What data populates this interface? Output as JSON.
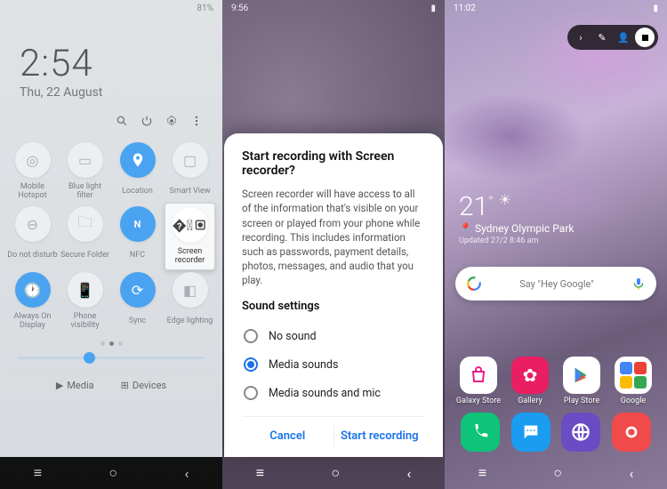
{
  "screen1": {
    "status_right": "81%",
    "time": "2:54",
    "date": "Thu, 22 August",
    "tiles": [
      {
        "label": "Mobile Hotspot",
        "active": false,
        "icon": "hotspot"
      },
      {
        "label": "Blue light filter",
        "active": false,
        "icon": "bluelight"
      },
      {
        "label": "Location",
        "active": true,
        "icon": "location"
      },
      {
        "label": "Smart View",
        "active": false,
        "icon": "smartview"
      },
      {
        "label": "Do not disturb",
        "active": false,
        "icon": "dnd"
      },
      {
        "label": "Secure Folder",
        "active": false,
        "icon": "folder"
      },
      {
        "label": "NFC",
        "active": true,
        "icon": "nfc"
      },
      {
        "label": "Screen recorder",
        "active": false,
        "icon": "record",
        "highlight": true
      },
      {
        "label": "Always On Display",
        "active": true,
        "icon": "aod"
      },
      {
        "label": "Phone visibility",
        "active": false,
        "icon": "visibility"
      },
      {
        "label": "Sync",
        "active": true,
        "icon": "sync"
      },
      {
        "label": "Edge lighting",
        "active": false,
        "icon": "edge"
      }
    ],
    "media_label": "Media",
    "devices_label": "Devices"
  },
  "screen2": {
    "status_time": "9:56",
    "dialog": {
      "title": "Start recording with Screen recorder?",
      "body": "Screen recorder will have access to all of the information that's visible on your screen or played from your phone while recording. This includes information such as passwords, payment details, photos, messages, and audio that you play.",
      "subtitle": "Sound settings",
      "options": [
        {
          "label": "No sound",
          "selected": false
        },
        {
          "label": "Media sounds",
          "selected": true
        },
        {
          "label": "Media sounds and mic",
          "selected": false
        }
      ],
      "cancel": "Cancel",
      "confirm": "Start recording"
    }
  },
  "screen3": {
    "status_time": "11:02",
    "weather": {
      "temp": "21",
      "unit": "°",
      "location": "Sydney Olympic Park",
      "updated": "Updated 27/2 8:46 am"
    },
    "search_placeholder": "Say \"Hey Google\"",
    "apps_row": [
      {
        "label": "Galaxy Store"
      },
      {
        "label": "Gallery"
      },
      {
        "label": "Play Store"
      },
      {
        "label": "Google"
      }
    ],
    "dock": [
      {
        "name": "phone"
      },
      {
        "name": "messages"
      },
      {
        "name": "internet"
      },
      {
        "name": "camera"
      }
    ]
  }
}
